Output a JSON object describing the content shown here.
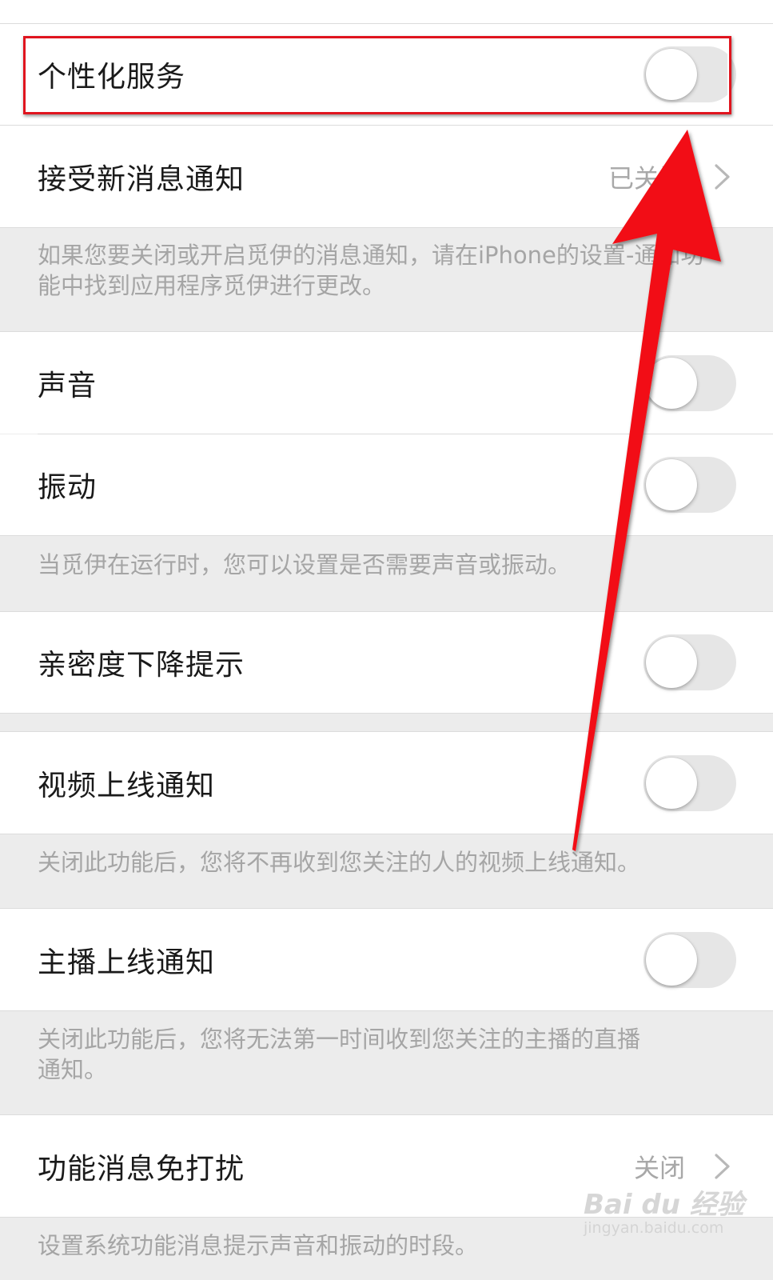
{
  "settings": {
    "personalized_service": {
      "label": "个性化服务",
      "enabled": false
    },
    "new_message_notify": {
      "label": "接受新消息通知",
      "value": "已关闭"
    },
    "note_notify": "如果您要关闭或开启觅伊的消息通知，请在iPhone的设置-通知功能中找到应用程序觅伊进行更改。",
    "sound": {
      "label": "声音",
      "enabled": false
    },
    "vibrate": {
      "label": "振动",
      "enabled": false
    },
    "note_sound_vibrate": "当觅伊在运行时，您可以设置是否需要声音或振动。",
    "intimacy_drop": {
      "label": "亲密度下降提示",
      "enabled": false
    },
    "video_online": {
      "label": "视频上线通知",
      "enabled": false
    },
    "note_video_online": "关闭此功能后，您将不再收到您关注的人的视频上线通知。",
    "anchor_online": {
      "label": "主播上线通知",
      "enabled": false
    },
    "note_anchor_online": "关闭此功能后，您将无法第一时间收到您关注的主播的直播通知。",
    "feature_dnd": {
      "label": "功能消息免打扰",
      "value": "关闭"
    },
    "note_feature_dnd": "设置系统功能消息提示声音和振动的时段。"
  },
  "watermark": {
    "brand": "Bai du 经验",
    "url": "jingyan.baidu.com"
  },
  "colors": {
    "highlight": "#e0141e",
    "arrow": "#f20d12",
    "toggle_off": "#e6e6e6"
  }
}
